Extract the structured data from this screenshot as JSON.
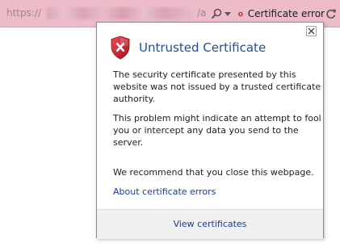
{
  "address_bar": {
    "url_prefix": "https://",
    "url_suffix": "/a",
    "cert_error_label": "Certificate error"
  },
  "popup": {
    "title": "Untrusted Certificate",
    "paragraph_1": "The security certificate presented by this website was not issued by a trusted certificate authority.",
    "paragraph_2": "This problem might indicate an attempt to fool you or intercept any data you send to the server.",
    "paragraph_3": "We recommend that you close this webpage.",
    "about_link": "About certificate errors",
    "footer_link": "View certificates"
  },
  "colors": {
    "address_bar_bg": "#eebcc9",
    "title": "#1f4e96",
    "link": "#1b3b9b",
    "error_red": "#d4213d"
  }
}
